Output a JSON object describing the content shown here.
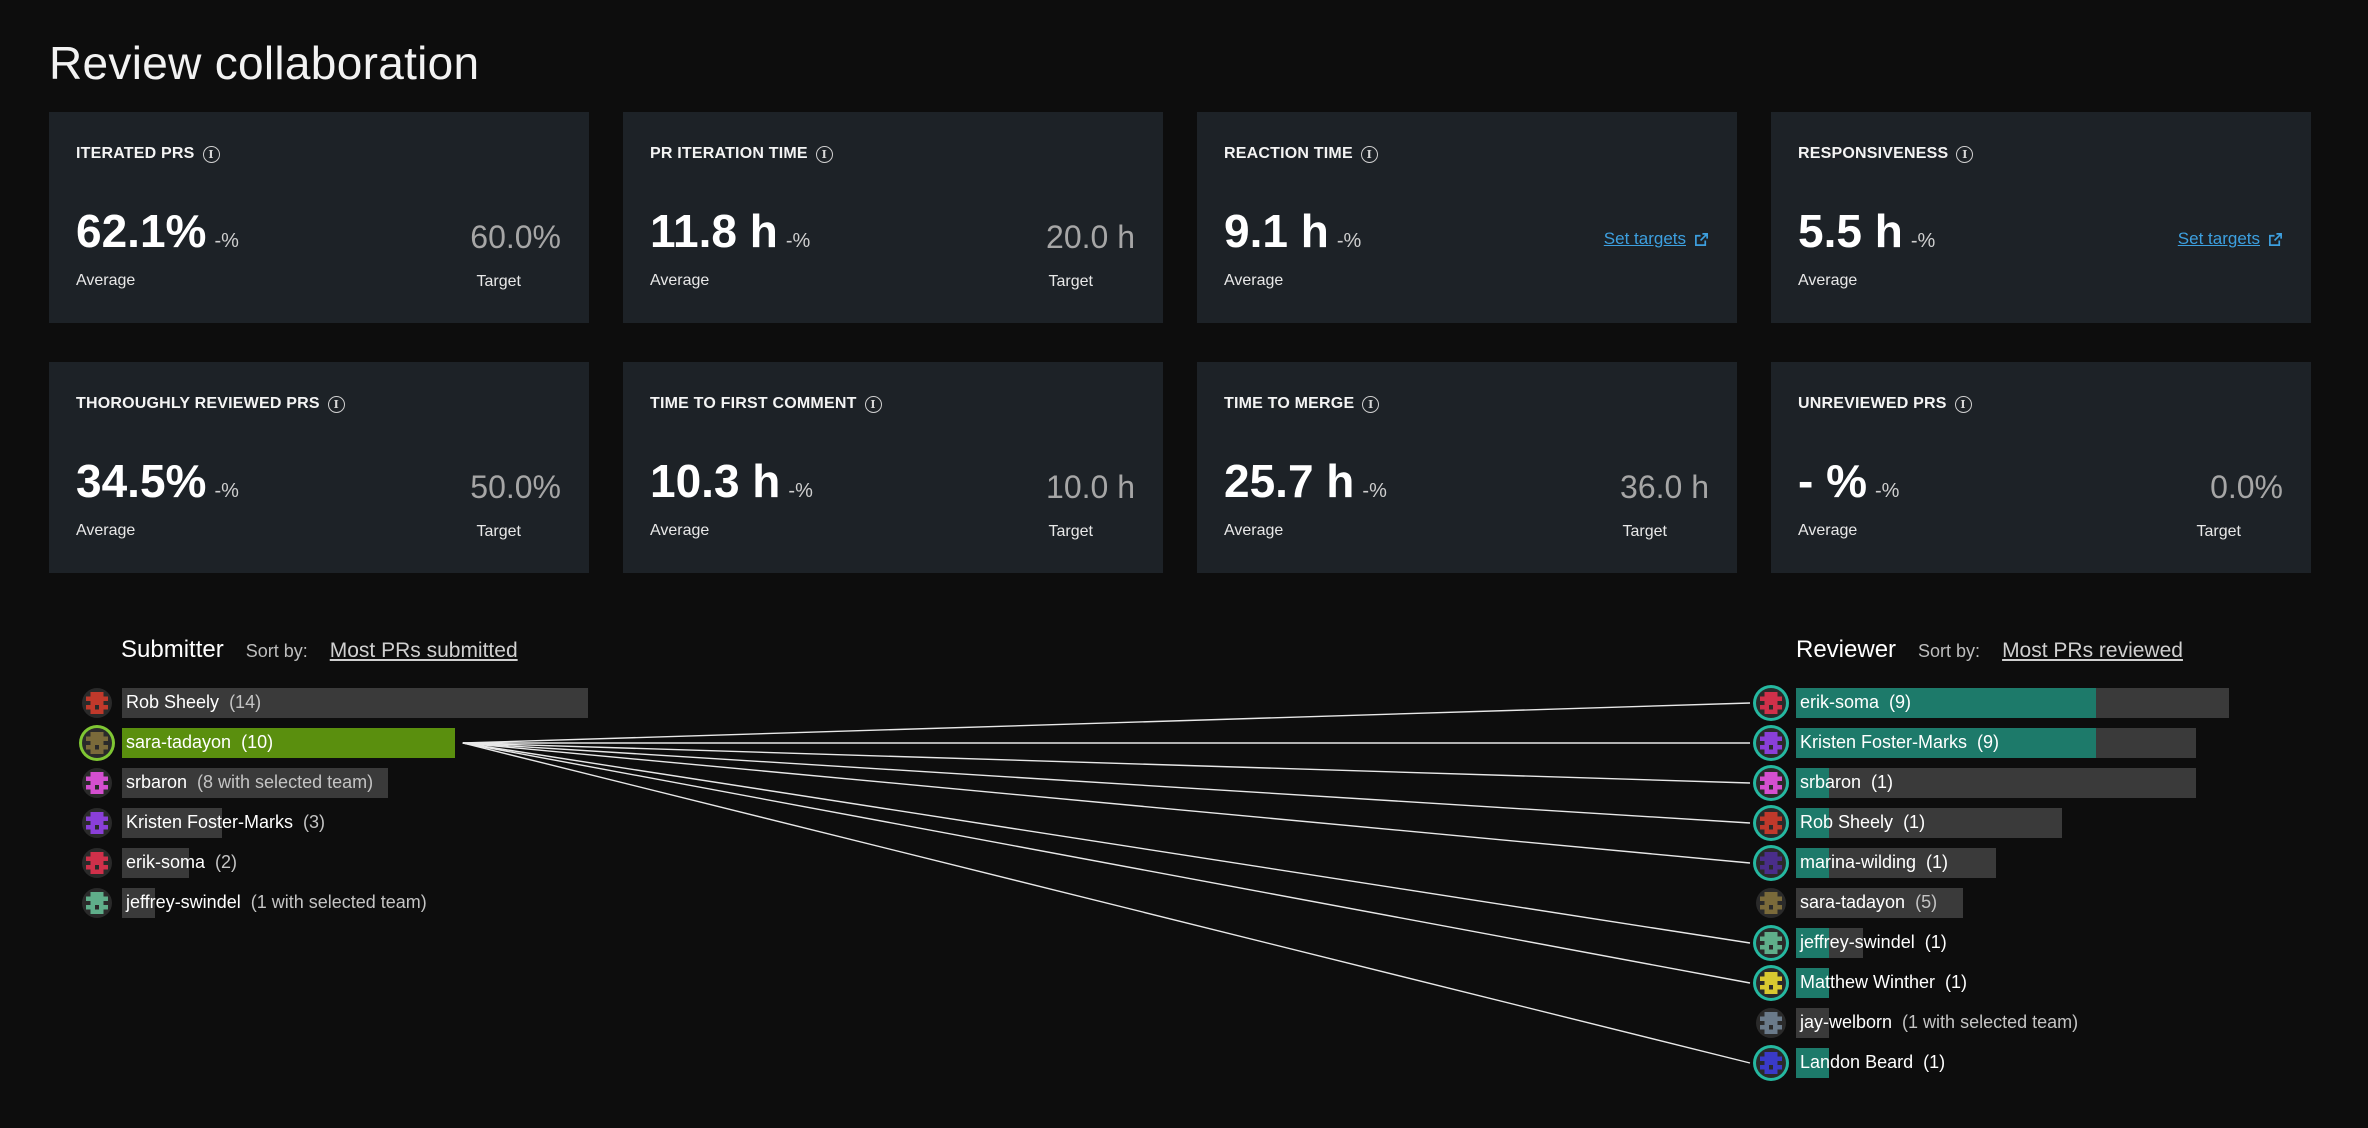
{
  "page": {
    "title": "Review collaboration"
  },
  "colors": {
    "card_bg": "#1d2227",
    "link": "#3da0e0",
    "submitter_selected": "#5a8f0e",
    "reviewer_fill": "#1d7a6a",
    "track": "#3a3a3a"
  },
  "metrics": [
    {
      "label": "ITERATED PRS",
      "value": "62.1%",
      "change": "-%",
      "avg_label": "Average",
      "target_value": "60.0%",
      "target_label": "Target"
    },
    {
      "label": "PR ITERATION TIME",
      "value": "11.8 h",
      "change": "-%",
      "avg_label": "Average",
      "target_value": "20.0 h",
      "target_label": "Target"
    },
    {
      "label": "REACTION TIME",
      "value": "9.1 h",
      "change": "-%",
      "avg_label": "Average",
      "set_targets": "Set targets"
    },
    {
      "label": "RESPONSIVENESS",
      "value": "5.5 h",
      "change": "-%",
      "avg_label": "Average",
      "set_targets": "Set targets"
    },
    {
      "label": "THOROUGHLY REVIEWED PRS",
      "value": "34.5%",
      "change": "-%",
      "avg_label": "Average",
      "target_value": "50.0%",
      "target_label": "Target"
    },
    {
      "label": "TIME TO FIRST COMMENT",
      "value": "10.3 h",
      "change": "-%",
      "avg_label": "Average",
      "target_value": "10.0 h",
      "target_label": "Target"
    },
    {
      "label": "TIME TO MERGE",
      "value": "25.7 h",
      "change": "-%",
      "avg_label": "Average",
      "target_value": "36.0 h",
      "target_label": "Target"
    },
    {
      "label": "UNREVIEWED PRS",
      "value": "- %",
      "change": "-%",
      "avg_label": "Average",
      "target_value": "0.0%",
      "target_label": "Target"
    }
  ],
  "submitter": {
    "heading": "Submitter",
    "sort_label": "Sort by:",
    "sort_value": "Most PRs submitted",
    "rows": [
      {
        "name": "Rob Sheely",
        "count": "(14)",
        "value": 14,
        "selected": false,
        "avatar_color": "#c0392b"
      },
      {
        "name": "sara-tadayon",
        "count": "(10)",
        "value": 10,
        "selected": true,
        "avatar_color": "#7a6a3a"
      },
      {
        "name": "srbaron",
        "count": "(8 with selected team)",
        "value": 8,
        "selected": false,
        "avatar_color": "#d44fd0"
      },
      {
        "name": "Kristen Foster-Marks",
        "count": "(3)",
        "value": 3,
        "selected": false,
        "avatar_color": "#8a3fd8"
      },
      {
        "name": "erik-soma",
        "count": "(2)",
        "value": 2,
        "selected": false,
        "avatar_color": "#d0304a"
      },
      {
        "name": "jeffrey-swindel",
        "count": "(1 with selected team)",
        "value": 1,
        "selected": false,
        "avatar_color": "#5fae8a"
      }
    ]
  },
  "reviewer": {
    "heading": "Reviewer",
    "sort_label": "Sort by:",
    "sort_value": "Most PRs reviewed",
    "rows": [
      {
        "name": "erik-soma",
        "count": "(9)",
        "total": 13,
        "with_selected": 9,
        "avatar_color": "#d0304a",
        "linked": true
      },
      {
        "name": "Kristen Foster-Marks",
        "count": "(9)",
        "total": 12,
        "with_selected": 9,
        "avatar_color": "#8a3fd8",
        "linked": true
      },
      {
        "name": "srbaron",
        "count": "(1)",
        "total": 12,
        "with_selected": 1,
        "avatar_color": "#d44fd0",
        "linked": true
      },
      {
        "name": "Rob Sheely",
        "count": "(1)",
        "total": 8,
        "with_selected": 1,
        "avatar_color": "#c0392b",
        "linked": true
      },
      {
        "name": "marina-wilding",
        "count": "(1)",
        "total": 6,
        "with_selected": 1,
        "avatar_color": "#4a2d8a",
        "linked": true
      },
      {
        "name": "sara-tadayon",
        "count": "(5)",
        "total": 5,
        "with_selected": 0,
        "avatar_color": "#7a6a3a",
        "linked": false
      },
      {
        "name": "jeffrey-swindel",
        "count": "(1)",
        "total": 2,
        "with_selected": 1,
        "avatar_color": "#5fae8a",
        "linked": true
      },
      {
        "name": "Matthew Winther",
        "count": "(1)",
        "total": 1,
        "with_selected": 1,
        "avatar_color": "#d8c830",
        "linked": true
      },
      {
        "name": "jay-welborn",
        "count": "(1 with selected team)",
        "total": 1,
        "with_selected": 0,
        "avatar_color": "#6a7a8a",
        "linked": false
      },
      {
        "name": "Landon Beard",
        "count": "(1)",
        "total": 1,
        "with_selected": 1,
        "avatar_color": "#3a3ac8",
        "linked": true
      }
    ]
  }
}
